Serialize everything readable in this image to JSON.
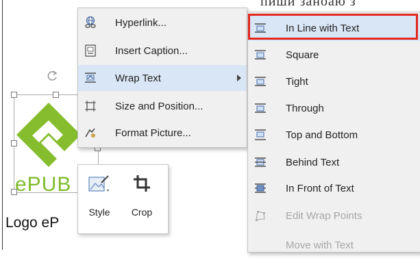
{
  "document": {
    "top_text": "пиши заноаю з",
    "logo_text": "ePUB",
    "caption": "Logo eP"
  },
  "context_menu": {
    "items": [
      {
        "label": "Hyperlink...",
        "icon": "hyperlink-icon"
      },
      {
        "label": "Insert Caption...",
        "icon": "insert-caption-icon"
      },
      {
        "label": "Wrap Text",
        "icon": "wrap-text-icon",
        "has_submenu": true,
        "highlighted": true
      },
      {
        "label": "Size and Position...",
        "icon": "size-position-icon"
      },
      {
        "label": "Format Picture...",
        "icon": "format-picture-icon"
      }
    ]
  },
  "wrap_submenu": {
    "items": [
      {
        "label": "In Line with Text",
        "icon": "inline-wrap-icon",
        "selected": true
      },
      {
        "label": "Square",
        "icon": "square-wrap-icon"
      },
      {
        "label": "Tight",
        "icon": "tight-wrap-icon"
      },
      {
        "label": "Through",
        "icon": "through-wrap-icon"
      },
      {
        "label": "Top and Bottom",
        "icon": "top-bottom-wrap-icon"
      },
      {
        "label": "Behind Text",
        "icon": "behind-text-icon"
      },
      {
        "label": "In Front of Text",
        "icon": "in-front-text-icon"
      },
      {
        "label": "Edit Wrap Points",
        "icon": "edit-wrap-points-icon",
        "disabled": true
      },
      {
        "label": "Move with Text",
        "icon": "",
        "disabled": true
      }
    ]
  },
  "mini_toolbar": {
    "style_label": "Style",
    "crop_label": "Crop"
  },
  "colors": {
    "menu_bg": "#f0f0f0",
    "highlight": "#d9e6f5",
    "selection_outline": "#e3261c",
    "epub_green": "#7fba2a"
  }
}
